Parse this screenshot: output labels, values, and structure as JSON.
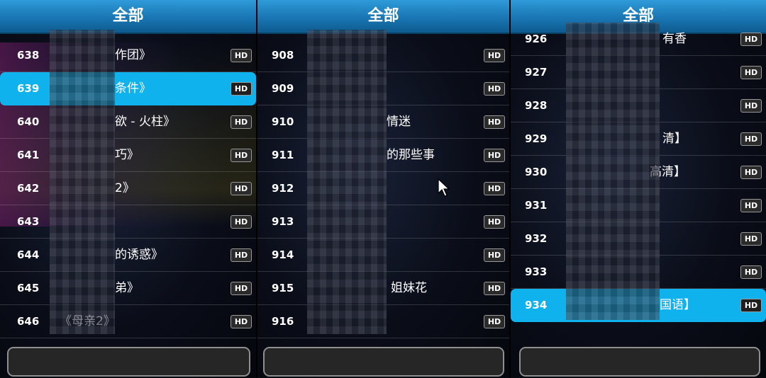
{
  "panels": [
    {
      "header": "全部",
      "rows": [
        {
          "num": "638",
          "title": "作团》",
          "hd": "HD"
        },
        {
          "num": "639",
          "title": "条件》",
          "hd": "HD",
          "selected": true
        },
        {
          "num": "640",
          "title": "欲 - 火柱》",
          "hd": "HD"
        },
        {
          "num": "641",
          "title": "巧》",
          "hd": "HD"
        },
        {
          "num": "642",
          "title": "2》",
          "hd": "HD"
        },
        {
          "num": "643",
          "title": "",
          "hd": "HD"
        },
        {
          "num": "644",
          "title": "的诱惑》",
          "hd": "HD"
        },
        {
          "num": "645",
          "title": "弟》",
          "hd": "HD"
        },
        {
          "num": "646",
          "title": "《母亲2》",
          "hd": "HD"
        }
      ]
    },
    {
      "header": "全部",
      "rows": [
        {
          "num": "908",
          "title": "",
          "hd": "HD"
        },
        {
          "num": "909",
          "title": "",
          "hd": "HD"
        },
        {
          "num": "910",
          "title": "情迷",
          "hd": "HD"
        },
        {
          "num": "911",
          "title": "的那些事",
          "hd": "HD"
        },
        {
          "num": "912",
          "title": "",
          "hd": "HD"
        },
        {
          "num": "913",
          "title": "",
          "hd": "HD"
        },
        {
          "num": "914",
          "title": "",
          "hd": "HD"
        },
        {
          "num": "915",
          "title": "姐妹花",
          "hd": "HD"
        },
        {
          "num": "916",
          "title": "",
          "hd": "HD"
        }
      ]
    },
    {
      "header": "全部",
      "rows": [
        {
          "num": "926",
          "title": "有香",
          "hd": "HD"
        },
        {
          "num": "927",
          "title": "",
          "hd": "HD"
        },
        {
          "num": "928",
          "title": "",
          "hd": "HD"
        },
        {
          "num": "929",
          "title": "清】",
          "hd": "HD"
        },
        {
          "num": "930",
          "title": "高清】",
          "hd": "HD"
        },
        {
          "num": "931",
          "title": "",
          "hd": "HD"
        },
        {
          "num": "932",
          "title": "",
          "hd": "HD"
        },
        {
          "num": "933",
          "title": "",
          "hd": "HD"
        },
        {
          "num": "934",
          "title": "国语】",
          "hd": "HD",
          "selected": true
        }
      ]
    }
  ],
  "icons": {
    "cursor": "arrow-cursor-icon",
    "hand": "hand-icon"
  },
  "colors": {
    "header_blue": "#1976b3",
    "selected_row": "#0fb2ec"
  }
}
